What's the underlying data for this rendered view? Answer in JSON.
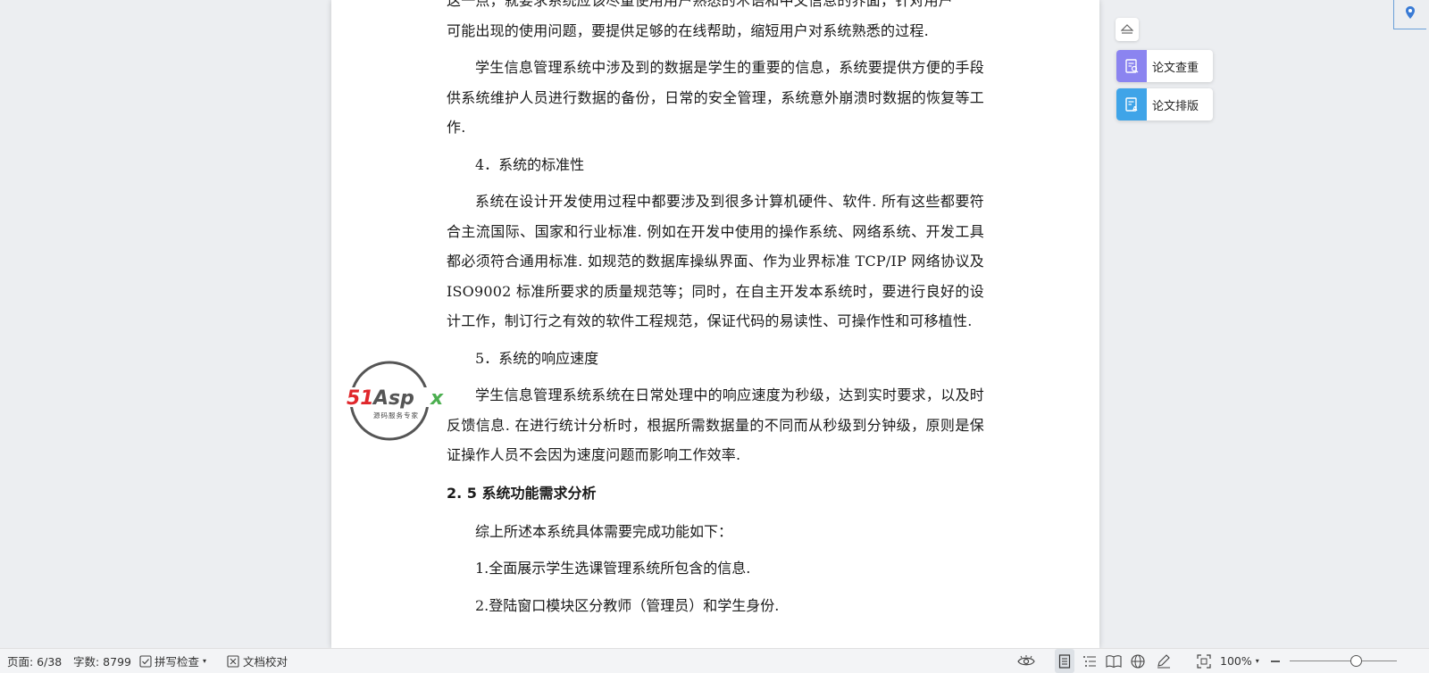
{
  "document": {
    "line0": "这一点，就要求系统应该尽量使用用户熟悉的术语和中文信息的界面，针对用户",
    "p_intro_end": "可能出现的使用问题，要提供足够的在线帮助，缩短用户对系统熟悉的过程.",
    "p_backup": "学生信息管理系统中涉及到的数据是学生的重要的信息，系统要提供方便的手段供系统维护人员进行数据的备份，日常的安全管理，系统意外崩溃时数据的恢复等工作.",
    "h4": "4．系统的标准性",
    "p_standard": "系统在设计开发使用过程中都要涉及到很多计算机硬件、软件. 所有这些都要符合主流国际、国家和行业标准. 例如在开发中使用的操作系统、网络系统、开发工具都必须符合通用标准. 如规范的数据库操纵界面、作为业界标准 TCP/IP 网络协议及 ISO9002 标准所要求的质量规范等；同时，在自主开发本系统时，要进行良好的设计工作，制订行之有效的软件工程规范，保证代码的易读性、可操作性和可移植性.",
    "h5": "5．系统的响应速度",
    "p_speed": "学生信息管理系统系统在日常处理中的响应速度为秒级，达到实时要求，以及时反馈信息. 在进行统计分析时，根据所需数据量的不同而从秒级到分钟级，原则是保证操作人员不会因为速度问题而影响工作效率.",
    "section_title": "2. 5 系统功能需求分析",
    "p_summary": "综上所述本系统具体需要完成功能如下：",
    "item1": "1.全面展示学生选课管理系统所包含的信息.",
    "item2": "2.登陆窗口模块区分教师（管理员）和学生身份."
  },
  "watermark": {
    "brand": "51Aspx",
    "tagline": "源码服务专家",
    "color_red": "#e0262b",
    "color_gray": "#555555",
    "color_green": "#4caf50"
  },
  "side_tools": {
    "collapse_icon": "eject-icon",
    "check_label": "论文查重",
    "check_color": "#8b84f0",
    "format_label": "论文排版",
    "format_color": "#3fa4e8"
  },
  "status_bar": {
    "page": "页面: 6/38",
    "word_count": "字数: 8799",
    "spell_check": "拼写检查",
    "proofread": "文档校对",
    "zoom": "100%"
  }
}
